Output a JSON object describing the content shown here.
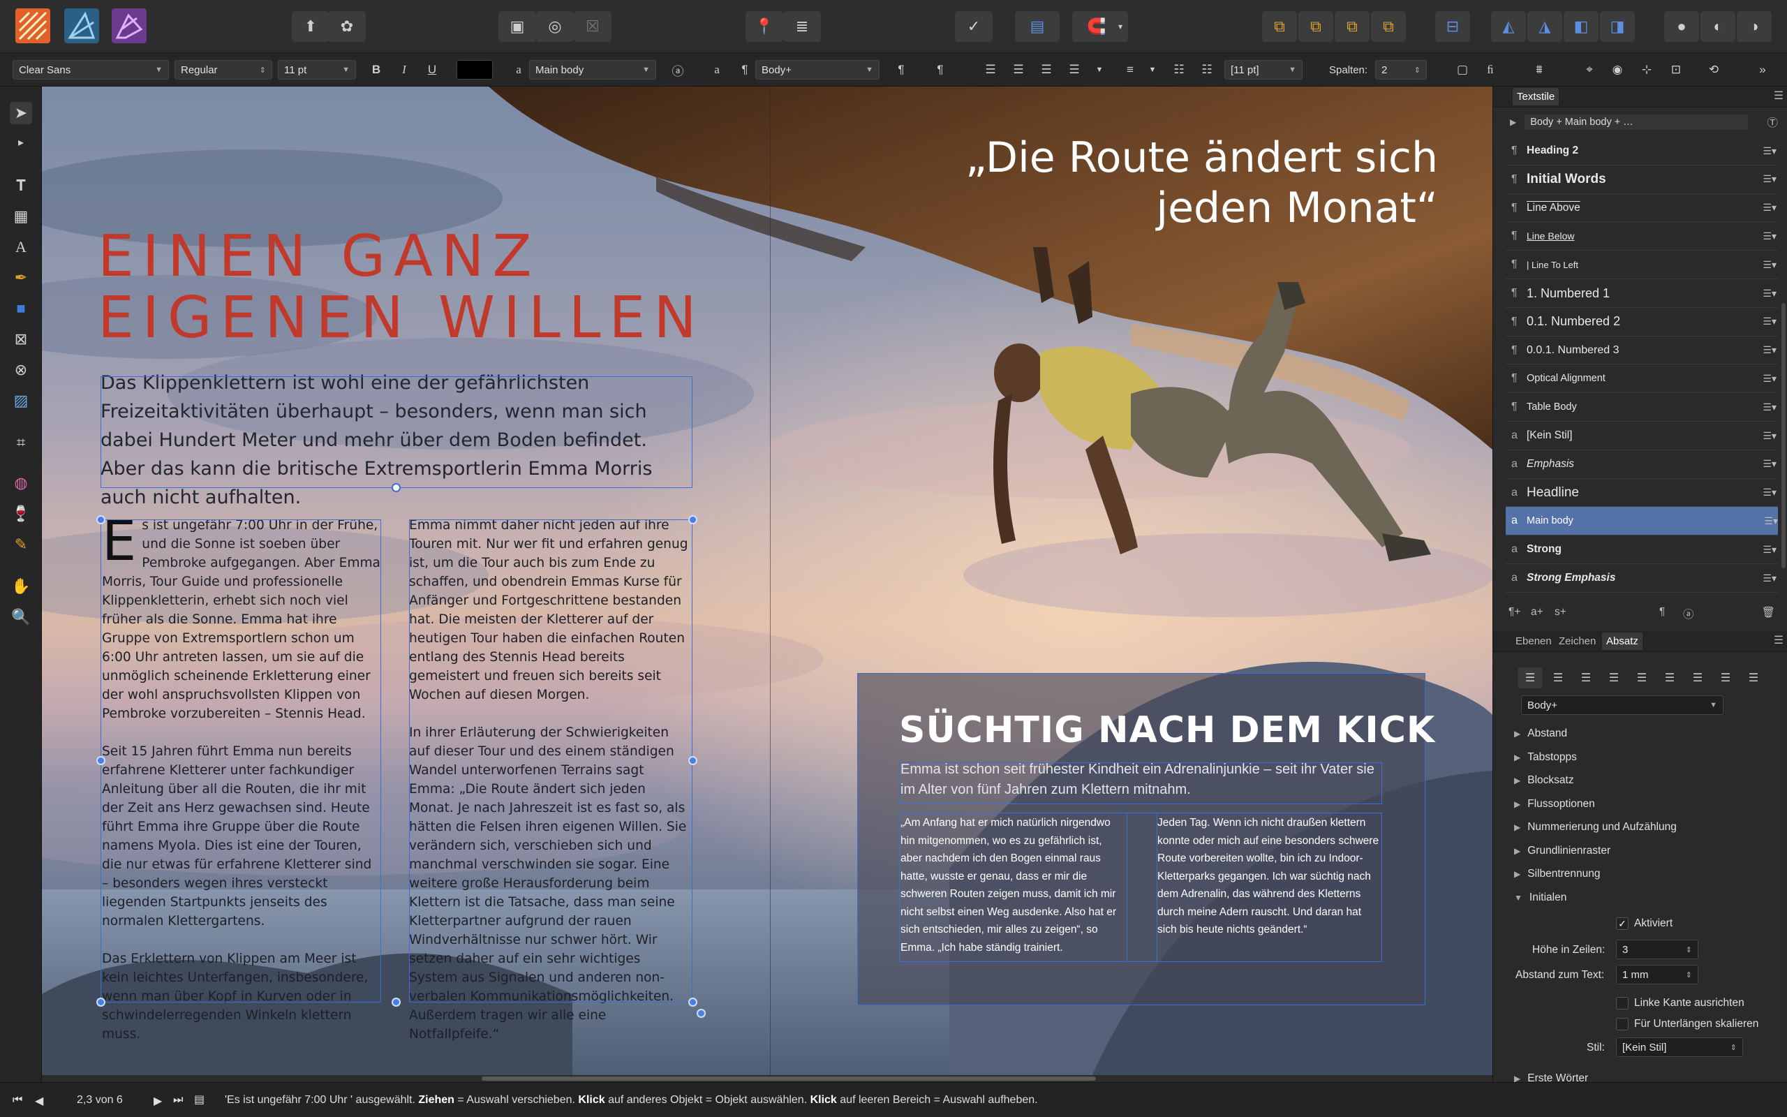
{
  "toolbar": {
    "personas": [
      "publisher-persona",
      "designer-persona",
      "photo-persona"
    ]
  },
  "context": {
    "font_family": "Clear Sans",
    "font_style": "Regular",
    "font_size": "11 pt",
    "bold": "B",
    "italic": "I",
    "underline": "U",
    "char_style": "Main body",
    "para_style": "Body+",
    "leading": "[11 pt]",
    "columns_label": "Spalten:",
    "columns_value": "2"
  },
  "document": {
    "headline_line1": "EINEN GANZ",
    "headline_line2": "EIGENEN WILLEN",
    "lead": "Das Klippenklettern ist wohl eine der gefährlichsten Freizeitaktivitäten überhaupt – besonders, wenn man sich dabei Hundert Meter und mehr über dem Boden befindet. Aber das kann die britische Extremsportlerin Emma Morris auch nicht aufhalten.",
    "dropcap": "E",
    "col1_p1": "s ist ungefähr 7:00 Uhr in der Frühe, und die Sonne ist soeben über Pembroke aufgegangen. Aber Emma Morris, Tour Guide und professionelle Klippenkletterin, erhebt sich noch viel früher als die Sonne. Emma hat ihre Gruppe von Extremsportlern schon um 6:00 Uhr antreten lassen, um sie auf die unmöglich scheinende Erkletterung einer der wohl anspruchsvollsten Klippen von Pembroke vorzubereiten – Stennis Head.",
    "col1_p2": "Seit 15 Jahren führt Emma nun bereits erfahrene Kletterer unter fachkundiger Anleitung über all die Routen, die ihr mit der Zeit ans Herz gewachsen sind. Heute führt Emma ihre Gruppe über die Route namens Myola. Dies ist eine der Touren, die nur etwas für erfahrene Kletterer sind – besonders wegen ihres versteckt liegenden Startpunkts jenseits des normalen Klettergartens.",
    "col1_p3": "Das Erklettern von Klippen am Meer ist kein leichtes Unterfangen, insbesondere, wenn man über Kopf in Kurven oder in schwindelerregenden Winkeln klettern muss.",
    "col2_p1": "Emma nimmt daher nicht jeden auf ihre Touren mit. Nur wer fit und erfahren genug ist, um die Tour auch bis zum Ende zu schaffen, und obendrein Emmas Kurse für Anfänger und Fortgeschrittene bestanden hat. Die meisten der Kletterer auf der heutigen Tour haben die einfachen Routen entlang des Stennis Head bereits gemeistert und freuen sich bereits seit Wochen auf diesen Morgen.",
    "col2_p2": "In ihrer Erläuterung der Schwierigkeiten auf dieser Tour und des einem ständigen Wandel unterworfenen Terrains sagt Emma: „Die Route ändert sich jeden Monat. Je nach Jahreszeit ist es fast so, als hätten die Felsen ihren eigenen Willen. Sie verändern sich, verschieben sich und manchmal verschwinden sie sogar. Eine weitere große Herausforderung beim Klettern ist die Tatsache, dass man seine Kletterpartner aufgrund der rauen Windverhältnisse nur schwer hört. Wir setzen daher auf ein sehr wichtiges System aus Signalen und anderen non-verbalen Kommunikationsmöglichkeiten. Außerdem tragen wir alle eine Notfallpfeife.“",
    "quote_line1": "„Die Route ändert sich",
    "quote_line2": "jeden Monat“",
    "kick_title": "SÜCHTIG NACH DEM KICK",
    "kick_sub": "Emma ist schon seit frühester Kindheit ein Adrenalinjunkie – seit ihr Vater sie im Alter von fünf Jahren zum Klettern mitnahm.",
    "kick_c1": "„Am Anfang hat er mich natürlich nirgendwo hin mitgenommen, wo es zu gefährlich ist, aber nachdem ich den Bogen einmal raus hatte, wusste er genau, dass er mir die schweren Routen zeigen muss, damit ich mir nicht selbst einen Weg ausdenke. Also hat er sich entschieden, mir alles zu zeigen“, so Emma. „Ich habe ständig trainiert.",
    "kick_c2": "Jeden Tag. Wenn ich nicht draußen klettern konnte oder mich auf eine besonders schwere Route vorbereiten wollte, bin ich zu Indoor-Kletterparks gegangen. Ich war süchtig nach dem Adrenalin, das während des Kletterns durch meine Adern rauscht. Und daran hat sich bis heute nichts geändert.“"
  },
  "panel": {
    "textstyles_tab": "Textstile",
    "current_style": "Body + Main body + …",
    "styles": [
      {
        "pil": "¶",
        "name": "Heading 2"
      },
      {
        "pil": "¶",
        "name": "Initial Words"
      },
      {
        "pil": "¶",
        "name": "Line Above"
      },
      {
        "pil": "¶",
        "name": "Line Below"
      },
      {
        "pil": "¶",
        "name": "|    Line To Left"
      },
      {
        "pil": "¶",
        "name": "1.   Numbered 1"
      },
      {
        "pil": "¶",
        "name": "0.1.      Numbered 2"
      },
      {
        "pil": "¶",
        "name": "0.0.1.      Numbered 3"
      },
      {
        "pil": "¶",
        "name": "Optical Alignment"
      },
      {
        "pil": "¶",
        "name": "Table Body"
      },
      {
        "pil": "a",
        "name": "[Kein Stil]"
      },
      {
        "pil": "a",
        "name": "Emphasis"
      },
      {
        "pil": "a",
        "name": "Headline"
      },
      {
        "pil": "a",
        "name": "Main body"
      },
      {
        "pil": "a",
        "name": "Strong"
      },
      {
        "pil": "a",
        "name": "Strong Emphasis"
      }
    ],
    "tab_ebenen": "Ebenen",
    "tab_zeichen": "Zeichen",
    "tab_absatz": "Absatz",
    "para_style": "Body+",
    "sections": [
      "Abstand",
      "Tabstopps",
      "Blocksatz",
      "Flussoptionen",
      "Nummerierung und Aufzählung",
      "Grundlinienraster",
      "Silbentrennung",
      "Initialen"
    ],
    "aktiviert": "Aktiviert",
    "hoehe_label": "Höhe in Zeilen:",
    "hoehe_value": "3",
    "abstand_label": "Abstand zum Text:",
    "abstand_value": "1 mm",
    "linke_kante": "Linke Kante ausrichten",
    "unterlaengen": "Für Unterlängen skalieren",
    "stil_label": "Stil:",
    "stil_value": "[Kein Stil]",
    "erste_woerter": "Erste Wörter"
  },
  "status": {
    "page": "2,3 von 6",
    "msg_part1": "'Es ist ungefähr 7:00 Uhr ' ausgewählt. ",
    "ziehen": "Ziehen",
    "msg_part2": " = Auswahl verschieben. ",
    "klick": "Klick",
    "msg_part3": " auf anderes Objekt = Objekt auswählen. ",
    "klick2": "Klick",
    "msg_part4": " auf leeren Bereich = Auswahl aufheben."
  },
  "colors": {
    "accent_red": "#c0392b",
    "selection_blue": "#3b6fd6",
    "selected_row": "#5472a8"
  }
}
